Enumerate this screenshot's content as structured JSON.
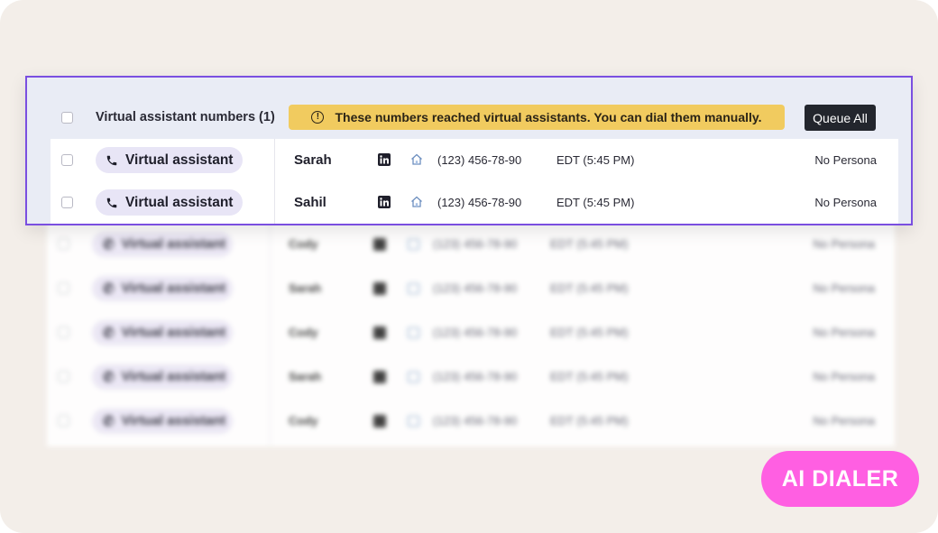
{
  "header": {
    "title": "Virtual assistant numbers (1)",
    "banner_text": "These numbers reached virtual assistants. You can dial them manually.",
    "queue_all_label": "Queue All"
  },
  "rows": [
    {
      "type_label": "Virtual assistant",
      "name": "Sarah",
      "phone": "(123) 456-78-90",
      "timezone": "EDT (5:45 PM)",
      "persona": "No Persona"
    },
    {
      "type_label": "Virtual assistant",
      "name": "Sahil",
      "phone": "(123) 456-78-90",
      "timezone": "EDT (5:45 PM)",
      "persona": "No Persona"
    }
  ],
  "blurred_rows": [
    {
      "type_label": "Virtual assistant",
      "name": "Cody",
      "phone": "(123) 456-78-90",
      "timezone": "EDT (5:45 PM)",
      "persona": "No Persona"
    },
    {
      "type_label": "Virtual assistant",
      "name": "Sarah",
      "phone": "(123) 456-78-90",
      "timezone": "EDT (5:45 PM)",
      "persona": "No Persona"
    },
    {
      "type_label": "Virtual assistant",
      "name": "Cody",
      "phone": "(123) 456-78-90",
      "timezone": "EDT (5:45 PM)",
      "persona": "No Persona"
    },
    {
      "type_label": "Virtual assistant",
      "name": "Sarah",
      "phone": "(123) 456-78-90",
      "timezone": "EDT (5:45 PM)",
      "persona": "No Persona"
    },
    {
      "type_label": "Virtual assistant",
      "name": "Cody",
      "phone": "(123) 456-78-90",
      "timezone": "EDT (5:45 PM)",
      "persona": "No Persona"
    }
  ],
  "badge": {
    "label": "AI DIALER"
  },
  "colors": {
    "accent_border": "#7a4fe0",
    "banner": "#f1cb5f",
    "pill": "#e8e5f6",
    "badge": "#ff5fe2",
    "button": "#23262d"
  },
  "icons": [
    "checkbox",
    "phone-icon",
    "linkedin-icon",
    "home-icon",
    "warning-icon"
  ]
}
